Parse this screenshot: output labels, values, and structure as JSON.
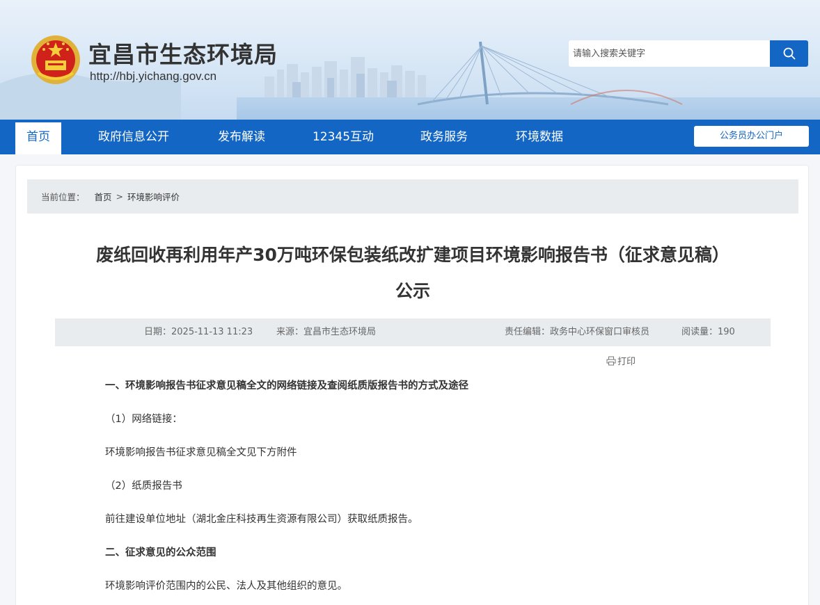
{
  "header": {
    "site_title": "宜昌市生态环境局",
    "site_url": "http://hbj.yichang.gov.cn",
    "search_placeholder": "请输入搜索关键字",
    "accent_color": "#1366c4"
  },
  "nav": {
    "items": [
      {
        "label": "首页",
        "active": true
      },
      {
        "label": "政府信息公开"
      },
      {
        "label": "发布解读"
      },
      {
        "label": "12345互动"
      },
      {
        "label": "政务服务"
      },
      {
        "label": "环境数据"
      }
    ],
    "portal_label": "公务员办公门户"
  },
  "breadcrumb": {
    "label": "当前位置：",
    "home": "首页",
    "separator": ">",
    "current": "环境影响评价"
  },
  "article": {
    "title_line1": "废纸回收再利用年产30万吨环保包装纸改扩建项目环境影响报告书（征求意见稿）",
    "title_line2": "公示",
    "meta": {
      "date": "日期：2025-11-13 11:23",
      "source": "来源：宜昌市生态环境局",
      "editor": "责任编辑：政务中心环保窗口审核员",
      "views": "阅读量：190"
    },
    "print_label": "打印",
    "paragraphs": [
      "一、环境影响报告书征求意见稿全文的网络链接及查阅纸质版报告书的方式及途径",
      "（1）网络链接：",
      "环境影响报告书征求意见稿全文见下方附件",
      "（2）纸质报告书",
      "前往建设单位地址（湖北金庄科技再生资源有限公司）获取纸质报告。",
      "二、征求意见的公众范围",
      "环境影响评价范围内的公民、法人及其他组织的意见。"
    ]
  },
  "icons": {
    "search": "search-icon",
    "print": "printer-icon",
    "emblem": "national-emblem-icon"
  }
}
